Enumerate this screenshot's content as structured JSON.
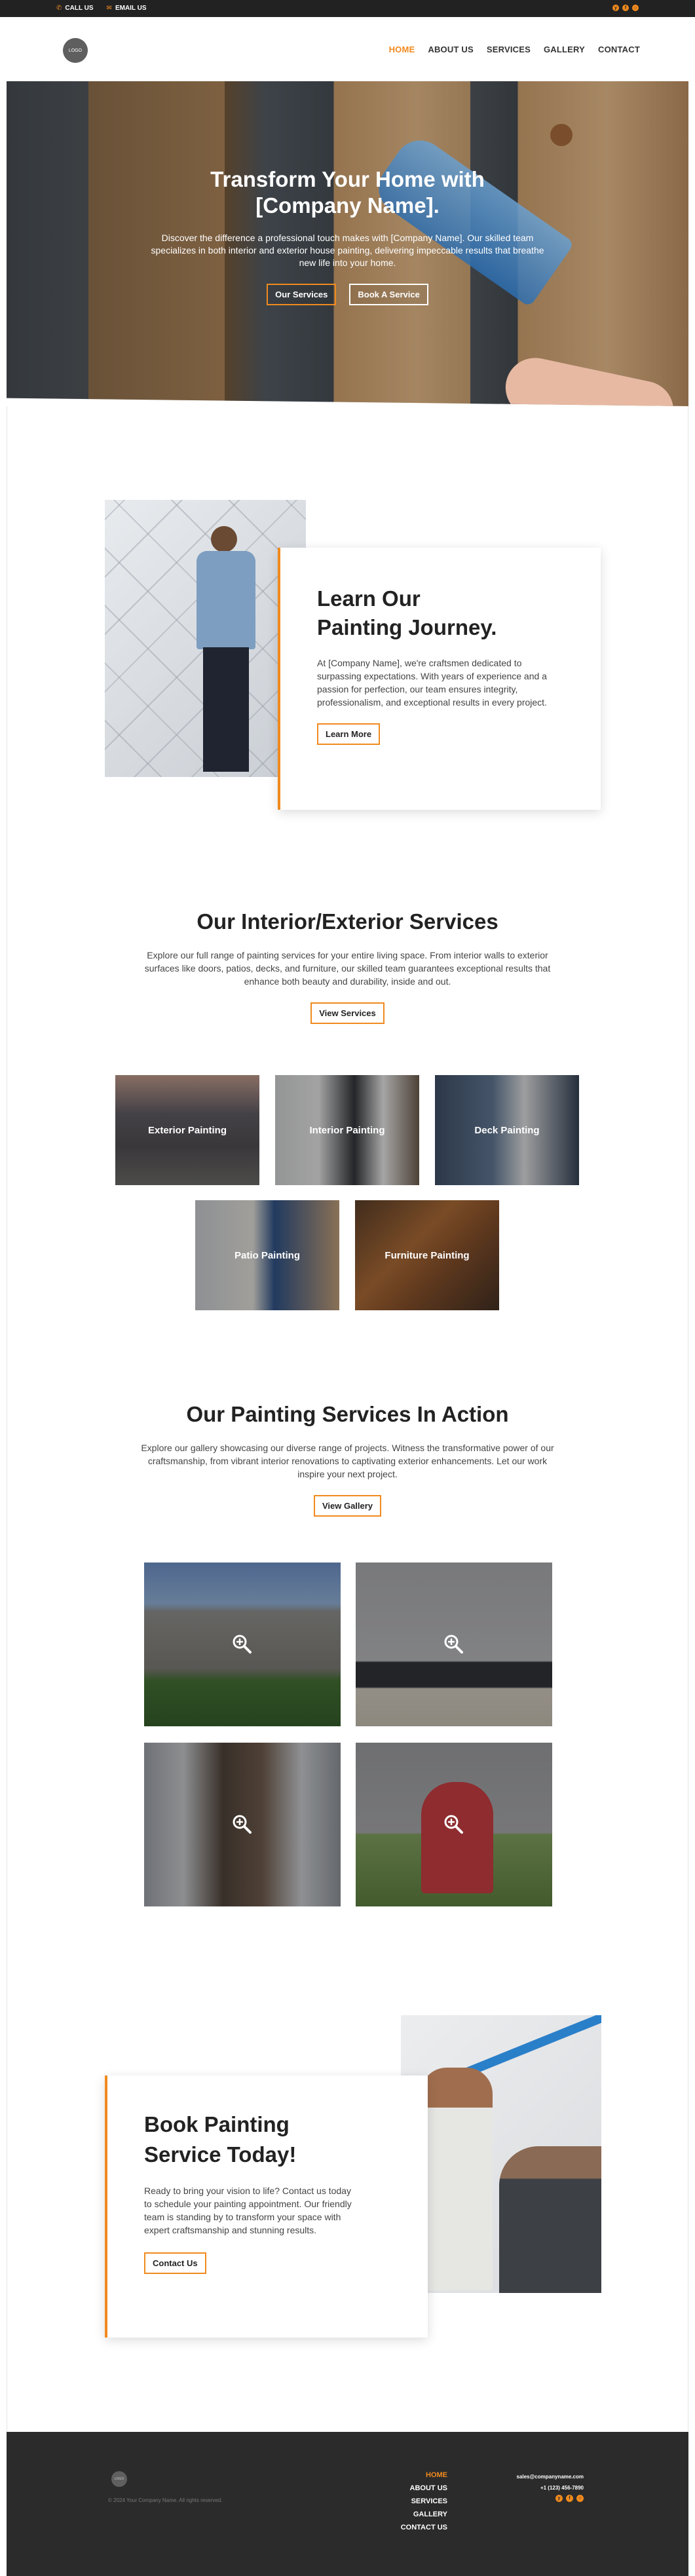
{
  "topbar": {
    "call_label": "CALL US",
    "email_label": "EMAIL US",
    "icons": [
      "phone-icon",
      "email-icon",
      "yelp-icon",
      "facebook-icon",
      "instagram-icon"
    ]
  },
  "header": {
    "logo_text": "LOGO",
    "nav": [
      "HOME",
      "ABOUT US",
      "SERVICES",
      "GALLERY",
      "CONTACT"
    ],
    "active_nav": "HOME"
  },
  "hero": {
    "title": "Transform Your Home with [Company Name].",
    "text": "Discover the difference a professional touch makes with [Company Name]. Our skilled team specializes in both interior and exterior house painting, delivering impeccable results that breathe new life into your home.",
    "btn_services": "Our Services",
    "btn_book": "Book A Service"
  },
  "about": {
    "title_line1": "Learn Our",
    "title_line2": "Painting Journey.",
    "text": "At [Company Name], we're craftsmen dedicated to surpassing expectations. With years of experience and a passion for perfection, our team ensures integrity, professionalism, and exceptional results in every project.",
    "button": "Learn More"
  },
  "services": {
    "title": "Our Interior/Exterior Services",
    "text": "Explore our full range of painting services for your entire living space. From interior walls to exterior surfaces like doors, patios, decks, and furniture, our skilled team guarantees exceptional results that enhance both beauty and durability, inside and out.",
    "button": "View Services",
    "tiles": [
      "Exterior Painting",
      "Interior Painting",
      "Deck Painting",
      "Patio Painting",
      "Furniture Painting"
    ]
  },
  "gallery": {
    "title": "Our Painting Services In Action",
    "text": "Explore our gallery showcasing our diverse range of projects. Witness the transformative power of our craftsmanship, from vibrant interior renovations to captivating exterior enhancements. Let our work inspire your next project.",
    "button": "View Gallery"
  },
  "booking": {
    "title_line1": "Book Painting",
    "title_line2": "Service Today!",
    "text": "Ready to bring your vision to life? Contact us today to schedule your painting appointment. Our friendly team is standing by to transform your space with expert craftsmanship and stunning results.",
    "button": "Contact Us"
  },
  "footer": {
    "logo_text": "LOGO",
    "copyright": "© 2024 Your Company Name. All rights reserved.",
    "nav": [
      "HOME",
      "ABOUT US",
      "SERVICES",
      "GALLERY",
      "CONTACT US"
    ],
    "email": "sales@companyname.com",
    "phone": "+1 (123) 456-7890"
  },
  "colors": {
    "accent": "#f08a1e",
    "dark": "#222222",
    "footer_bg": "#2b2b2b"
  }
}
